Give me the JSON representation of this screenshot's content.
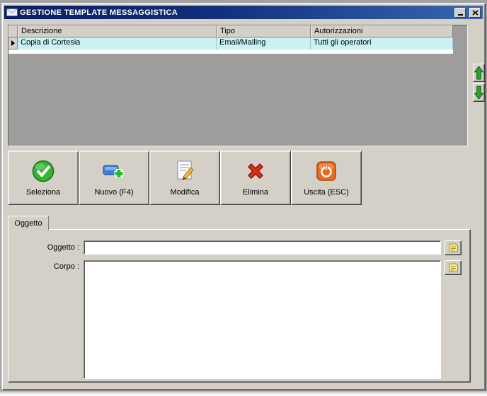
{
  "window": {
    "title": "GESTIONE TEMPLATE MESSAGGISTICA",
    "title_icon": "mail-envelope-icon",
    "minimize_icon": "minimize-icon",
    "close_icon": "close-icon"
  },
  "grid": {
    "columns": [
      {
        "label": "Descrizione"
      },
      {
        "label": "Tipo"
      },
      {
        "label": "Autorizzazioni"
      }
    ],
    "rows": [
      {
        "descrizione": "Copia di Cortesia",
        "tipo": "Email/Mailing",
        "autorizzazioni": "Tutti gli operatori",
        "selected": true
      }
    ]
  },
  "nav": {
    "up_icon": "arrow-up-icon",
    "down_icon": "arrow-down-icon"
  },
  "toolbar": {
    "buttons": [
      {
        "label": "Seleziona",
        "icon": "select-check-icon"
      },
      {
        "label": "Nuovo (F4)",
        "icon": "new-plus-icon"
      },
      {
        "label": "Modifica",
        "icon": "edit-pencil-icon"
      },
      {
        "label": "Elimina",
        "icon": "delete-x-icon"
      },
      {
        "label": "Uscita (ESC)",
        "icon": "exit-power-icon"
      }
    ]
  },
  "tabs": {
    "active_label": "Oggetto"
  },
  "form": {
    "oggetto_label": "Oggetto :",
    "oggetto_value": "",
    "corpo_label": "Corpo :",
    "corpo_value": "",
    "field_button_icon": "note-icon"
  },
  "colors": {
    "titlebar_start": "#081f60",
    "titlebar_end": "#3867ad",
    "selected_row": "#c8f2f4",
    "window_face": "#d4d0c8"
  }
}
